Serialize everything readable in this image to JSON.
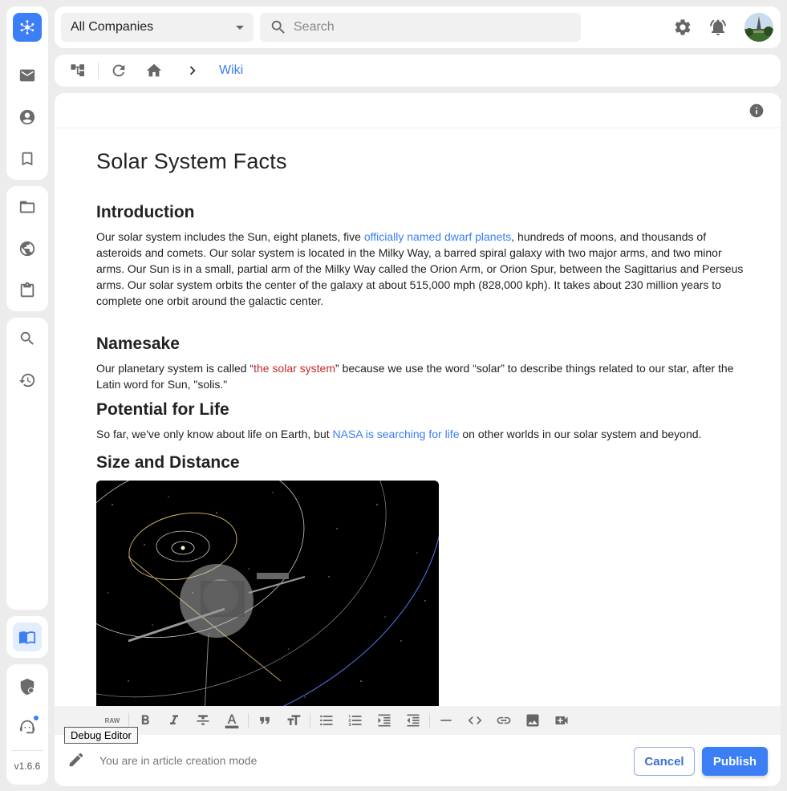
{
  "topbar": {
    "company_selector": "All Companies",
    "search_placeholder": "Search"
  },
  "breadcrumb": {
    "current": "Wiki"
  },
  "article": {
    "title": "Solar System Facts",
    "sections": [
      {
        "heading": "Introduction",
        "p_before_link": "Our solar system includes the Sun, eight planets, five ",
        "link": "officially named dwarf planets",
        "p_after_link": ", hundreds of moons, and thousands of asteroids and comets. Our solar system is located in the Milky Way, a barred spiral galaxy with two major arms, and two minor arms. Our Sun is in a small, partial arm of the Milky Way called the Orion Arm, or Orion Spur, between the Sagittarius and Perseus arms. Our solar system orbits the center of the galaxy at about 515,000 mph (828,000 kph). It takes about 230 million years to complete one orbit around the galactic center."
      },
      {
        "heading": "Namesake",
        "p_before_link": "Our planetary system is called “",
        "link": "the solar system",
        "p_after_link": "” because we use the word “solar” to describe things related to our star, after the Latin word for Sun, \"solis.\""
      },
      {
        "heading": "Potential for Life",
        "p_before_link": "So far, we've only know about life on Earth, but ",
        "link": "NASA is searching for life",
        "p_after_link": " on other worlds in our solar system and beyond."
      },
      {
        "heading": "Size and Distance"
      }
    ]
  },
  "toolbar": {
    "raw_label": "RAW",
    "tooltip": "Debug Editor"
  },
  "footer": {
    "mode_text": "You are in article creation mode",
    "cancel_label": "Cancel",
    "publish_label": "Publish"
  },
  "sidebar": {
    "version": "v1.6.6"
  },
  "icons": [
    "logo-icon",
    "mail-icon",
    "account-icon",
    "bookmark-icon",
    "folder-icon",
    "globe-icon",
    "clipboard-icon",
    "search-icon",
    "history-icon",
    "wiki-book-icon",
    "security-shield-icon",
    "support-agent-icon",
    "settings-gear-icon",
    "notification-bell-icon",
    "info-icon",
    "bold-icon",
    "italic-icon",
    "strikethrough-icon",
    "text-color-icon",
    "quote-icon",
    "text-size-icon",
    "bullet-list-icon",
    "numbered-list-icon",
    "indent-icon",
    "outdent-icon",
    "horizontal-rule-icon",
    "code-icon",
    "link-icon",
    "image-icon",
    "video-icon",
    "pencil-icon"
  ],
  "colors": {
    "accent": "#3b7ef6",
    "red_link": "#c62828"
  }
}
